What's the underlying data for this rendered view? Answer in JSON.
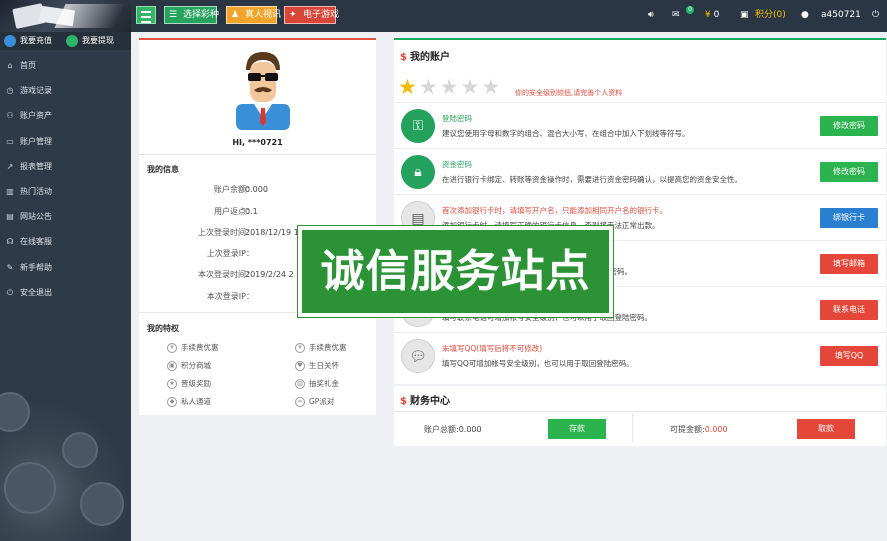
{
  "topbar": {
    "green_button": "选择彩种",
    "orange_button": "真人视讯",
    "red_button": "电子游戏",
    "mail_badge": "0",
    "balance_symbol": "¥",
    "balance": "0",
    "points_label": "积分(0)",
    "username": "a450721"
  },
  "sidebar": {
    "recharge_label": "我要充值",
    "withdraw_label": "我要提现",
    "items": [
      {
        "label": "首页",
        "icon": "home-icon"
      },
      {
        "label": "游戏记录",
        "icon": "record-icon"
      },
      {
        "label": "账户资产",
        "icon": "user-icon"
      },
      {
        "label": "账户管理",
        "icon": "folder-icon"
      },
      {
        "label": "报表管理",
        "icon": "chart-icon"
      },
      {
        "label": "热门活动",
        "icon": "gift-icon"
      },
      {
        "label": "网站公告",
        "icon": "notice-icon"
      },
      {
        "label": "在线客服",
        "icon": "headset-icon"
      },
      {
        "label": "新手帮助",
        "icon": "help-icon"
      },
      {
        "label": "安全退出",
        "icon": "power-icon"
      }
    ]
  },
  "profile": {
    "greeting": "HI, ***0721",
    "info_title": "我的信息",
    "info_rows": [
      {
        "label": "账户余额：",
        "value": "0.000"
      },
      {
        "label": "用户返点：",
        "value": "0.1"
      },
      {
        "label": "上次登录时间：",
        "value": "2018/12/19 1"
      },
      {
        "label": "上次登录IP：",
        "value": ""
      },
      {
        "label": "本次登录时间：",
        "value": "2019/2/24 2"
      },
      {
        "label": "本次登录IP：",
        "value": ""
      }
    ],
    "privilege_title": "我的特权",
    "privileges": [
      "手续费优惠",
      "手续费优惠",
      "积分商城",
      "生日关怀",
      "晋级奖励",
      "抽奖礼金",
      "私人通道",
      "GP派对"
    ]
  },
  "account": {
    "title": "我的账户",
    "star_hint": "你的安全级别较低,请完善个人资料",
    "stars_on": 1,
    "stars_total": 5,
    "rows": [
      {
        "title": "登陆密码",
        "title_color": "#2aa35f",
        "desc": "建议您使用字母和数字的组合、混合大小写、在组合中加入下划线等符号。",
        "button": "修改密码",
        "icon": "key-icon"
      },
      {
        "title": "资金密码",
        "title_color": "#2aa35f",
        "desc": "在进行银行卡绑定、转账等资金操作时，需要进行资金密码确认，以提高您的资金安全性。",
        "button": "修改密码",
        "icon": "lock-icon"
      },
      {
        "title": "首次添加银行卡时，请填写开户名，只能添加相同开户名的银行卡。",
        "title_color": "#e24a3a",
        "desc": "添加银行卡时，请填写正确的银行卡信息，否则将无法正常出款。",
        "button": "绑银行卡",
        "icon": "bankcard-icon"
      },
      {
        "title": "",
        "title_color": "#e24a3a",
        "desc": "陆密码。",
        "button": "填写邮箱",
        "icon": "mail-icon"
      },
      {
        "title": "",
        "title_color": "#e24a3a",
        "desc": "填写联系电话可增加帐号安全级别，也可以用于取回登陆密码。",
        "button": "联系电话",
        "icon": "phone-icon"
      },
      {
        "title": "未填写QQ(填写后将不可修改)",
        "title_color": "#e24a3a",
        "desc": "填写QQ可增加帐号安全级别，也可以用于取回登陆密码。",
        "button": "填写QQ",
        "icon": "chat-icon"
      }
    ]
  },
  "finance": {
    "title": "财务中心",
    "total_label": "账户总额:",
    "total_value": "0.000",
    "deposit_button": "存款",
    "available_label": "可提金额:",
    "available_value": "0.000",
    "withdraw_button": "取款"
  },
  "banner": {
    "text": "诚信服务站点"
  }
}
